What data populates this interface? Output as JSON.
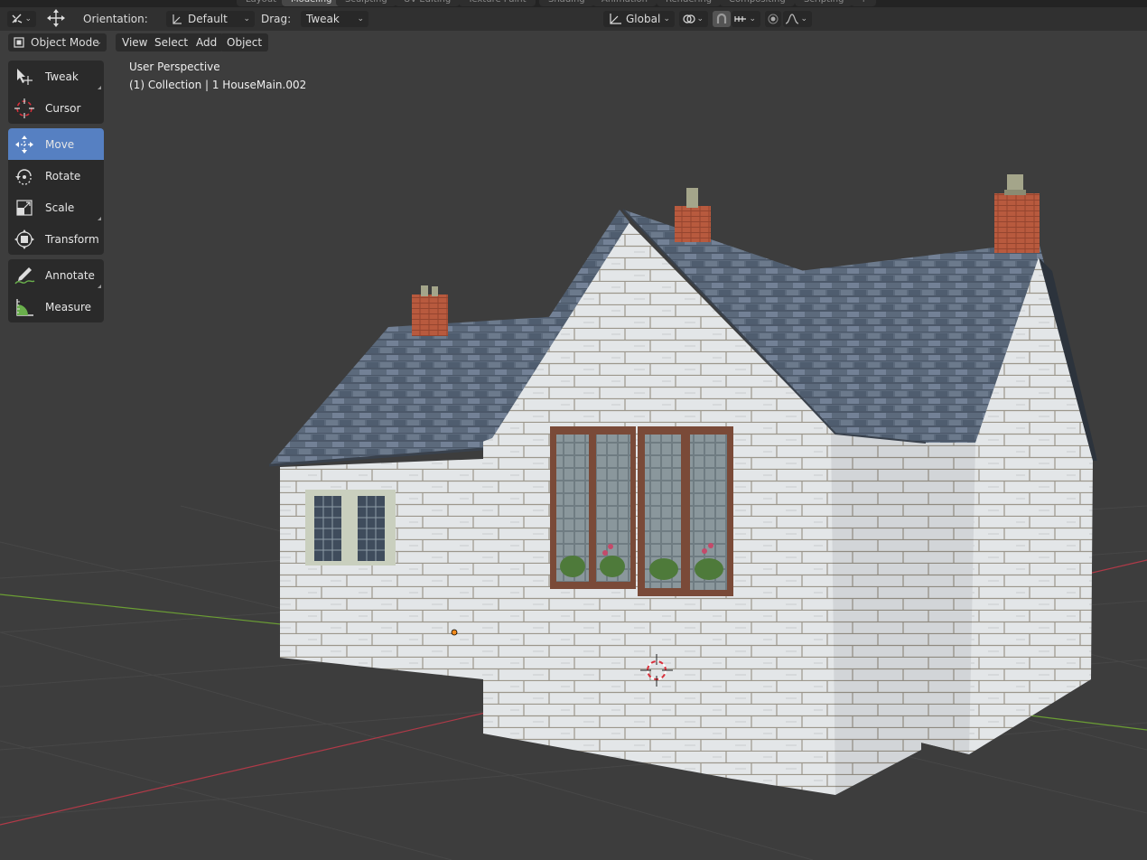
{
  "workspace_tabs": [
    "Layout",
    "Modeling",
    "Sculpting",
    "UV Editing",
    "Texture Paint",
    "Shading",
    "Animation",
    "Rendering",
    "Compositing",
    "Scripting",
    "+"
  ],
  "active_workspace_index": 1,
  "header": {
    "orientation_label": "Orientation:",
    "orientation_value": "Default",
    "drag_label": "Drag:",
    "drag_value": "Tweak",
    "transform_orientation_value": "Global"
  },
  "mode_menu": {
    "mode_value": "Object Mode",
    "menus": [
      "View",
      "Select",
      "Add",
      "Object"
    ]
  },
  "viewport": {
    "perspective_label": "User Perspective",
    "collection_label": "(1) Collection | 1 HouseMain.002"
  },
  "toolbar": {
    "groups": [
      [
        {
          "name": "tweak",
          "label": "Tweak",
          "icon": "tweak-icon",
          "corner": true
        },
        {
          "name": "cursor",
          "label": "Cursor",
          "icon": "cursor-icon",
          "corner": false
        }
      ],
      [
        {
          "name": "move",
          "label": "Move",
          "icon": "move-icon",
          "corner": false,
          "active": true
        },
        {
          "name": "rotate",
          "label": "Rotate",
          "icon": "rotate-icon",
          "corner": false
        },
        {
          "name": "scale",
          "label": "Scale",
          "icon": "scale-icon",
          "corner": true
        },
        {
          "name": "transform",
          "label": "Transform",
          "icon": "transform-icon",
          "corner": false
        }
      ],
      [
        {
          "name": "annotate",
          "label": "Annotate",
          "icon": "annotate-icon",
          "corner": true
        },
        {
          "name": "measure",
          "label": "Measure",
          "icon": "measure-icon",
          "corner": false
        }
      ]
    ]
  },
  "colors": {
    "active_tool": "#5680c2",
    "x_axis": "#b03a48",
    "y_axis": "#6b9e34",
    "cursor_red": "#d8303c"
  }
}
